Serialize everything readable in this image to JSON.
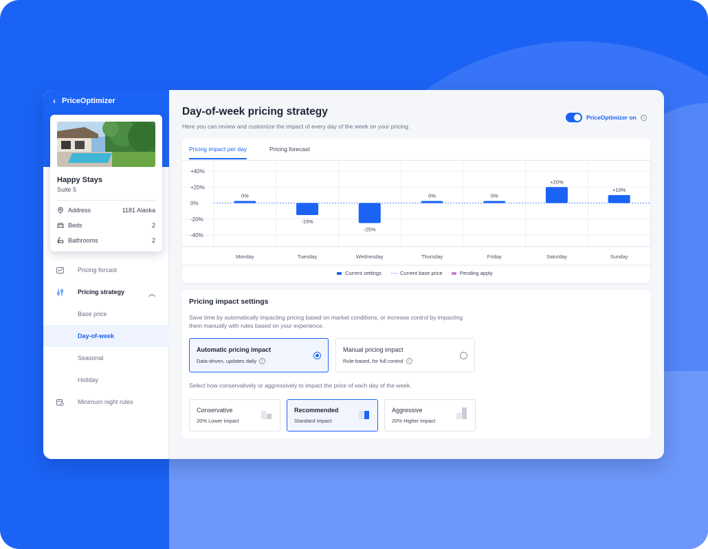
{
  "app": {
    "back_label": "PriceOptimizer"
  },
  "property": {
    "name": "Happy Stays",
    "unit": "Suite 5",
    "details": [
      {
        "label": "Address",
        "value": "1181 Alaska",
        "icon": "location-pin-icon"
      },
      {
        "label": "Beds",
        "value": "2",
        "icon": "bed-icon"
      },
      {
        "label": "Bathrooms",
        "value": "2",
        "icon": "bath-icon"
      }
    ]
  },
  "nav": {
    "pricing_forecast": "Pricing forcast",
    "pricing_strategy": "Pricing strategy",
    "base_price": "Base price",
    "day_of_week": "Day-of-week",
    "seasonal": "Seasonal",
    "holiday": "Holiday",
    "min_night_rules": "Minimum night rules"
  },
  "header": {
    "title": "Day-of-week pricing strategy",
    "subtitle": "Here you can review and customize the impact of every day of the week on your pricing.",
    "toggle_label": "PriceOptimizer on",
    "toggle_on": true
  },
  "tabs": [
    "Pricing impact per day",
    "Pricing forecast"
  ],
  "chart_data": {
    "type": "bar",
    "categories": [
      "Monday",
      "Tuesday",
      "Wednesday",
      "Thursday",
      "Friday",
      "Saturday",
      "Sunday"
    ],
    "values": [
      0,
      -15,
      -25,
      0,
      0,
      20,
      10
    ],
    "data_labels": [
      "0%",
      "-15%",
      "-25%",
      "0%",
      "0%",
      "+20%",
      "+10%"
    ],
    "y_ticks": [
      "+40%",
      "+20%",
      "0%",
      "-20%",
      "-40%"
    ],
    "ylim": [
      -40,
      40
    ],
    "legend": [
      "Current settings",
      "Current base price",
      "Pending apply"
    ],
    "colors": {
      "bar": "#1b63f5",
      "base_line": "#1b63f5",
      "pending": "#c77ad8"
    }
  },
  "settings": {
    "title": "Pricing impact settings",
    "description": "Save time by automatically impacting pricing based on market conditions, or increase control by impacting them manually with rules based on your experience.",
    "modes": [
      {
        "title": "Automatic pricing impact",
        "subtitle": "Data-driven, updates daily",
        "selected": true
      },
      {
        "title": "Manual pricing impact",
        "subtitle": "Rule-based, for full control",
        "selected": false
      }
    ],
    "levels_help": "Select how conservatively or aggressively to impact the price of each day of the week.",
    "levels": [
      {
        "title": "Conservative",
        "subtitle": "20% Lower impact",
        "selected": false
      },
      {
        "title": "Recommended",
        "subtitle": "Standard impact",
        "selected": true
      },
      {
        "title": "Aggressive",
        "subtitle": "20% Higher impact",
        "selected": false
      }
    ]
  }
}
